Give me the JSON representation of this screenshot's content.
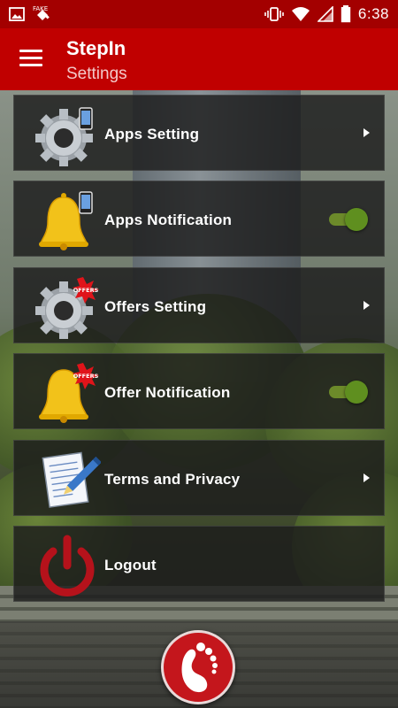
{
  "status_bar": {
    "time": "6:38",
    "icons": [
      "image-icon",
      "satellite-fake-gps-icon",
      "vibrate-icon",
      "wifi-icon",
      "signal-icon",
      "battery-icon"
    ]
  },
  "app_bar": {
    "title": "StepIn",
    "subtitle": "Settings"
  },
  "menu_items": [
    {
      "label": "Apps Setting",
      "icon": "gear-phone-icon",
      "control": "arrow"
    },
    {
      "label": "Apps Notification",
      "icon": "bell-phone-icon",
      "control": "toggle",
      "toggle_on": true
    },
    {
      "label": "Offers Setting",
      "icon": "gear-offer-icon",
      "control": "arrow"
    },
    {
      "label": "Offer Notification",
      "icon": "bell-offer-icon",
      "control": "toggle",
      "toggle_on": true
    },
    {
      "label": "Terms and Privacy",
      "icon": "document-pen-icon",
      "control": "arrow"
    },
    {
      "label": "Logout",
      "icon": "power-icon",
      "control": "none"
    }
  ],
  "bottom": {
    "logo": "footprint-logo-icon"
  },
  "colors": {
    "status_bar": "#a30000",
    "app_bar": "#c00000",
    "toggle_on": "#5f8f1f",
    "logo_red": "#c4161c"
  }
}
